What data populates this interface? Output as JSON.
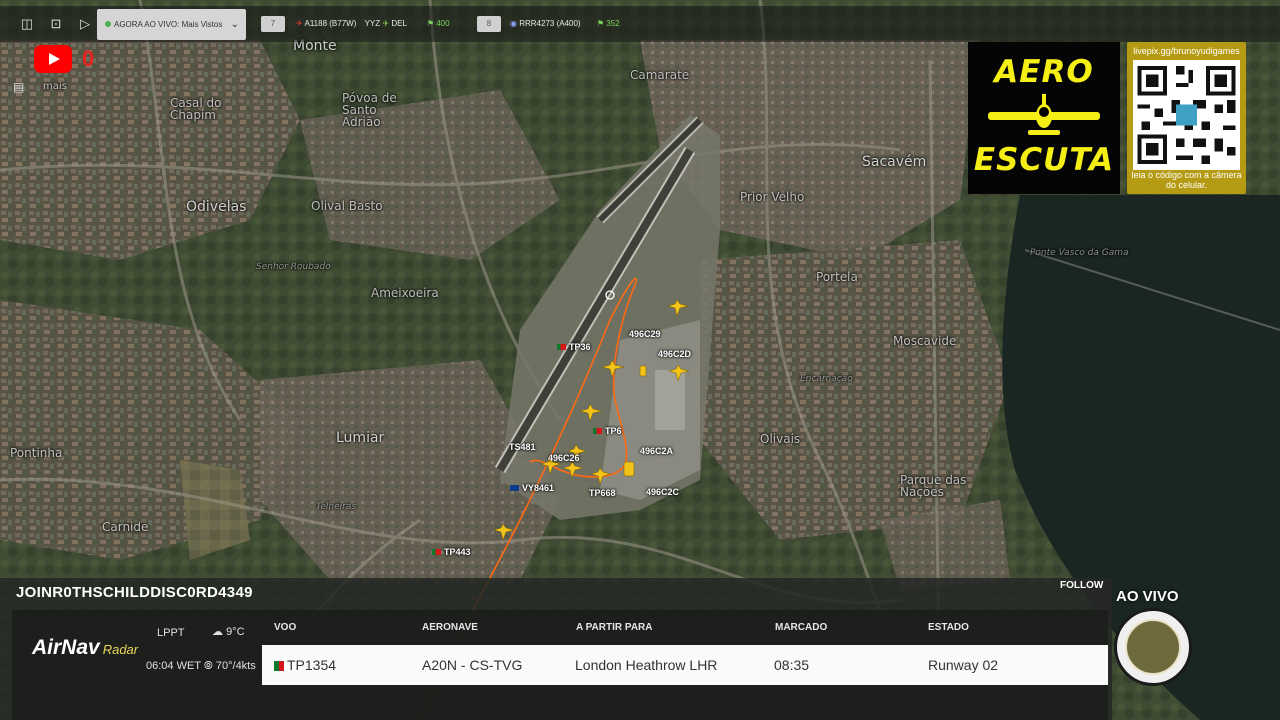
{
  "topbar": {
    "live_label": "AGORA AO VIVO: Mais Vistos",
    "slot1_number": "7",
    "slot1_flight": "A1188 (B77W)",
    "slot1_route_from": "YYZ",
    "slot1_route_to": "DEL",
    "slot1_count": "400",
    "slot2_number": "8",
    "slot2_flight": "RRR4273 (A400)",
    "slot2_count": "352"
  },
  "youtube": {
    "count": "0"
  },
  "map": {
    "places": [
      {
        "name": "Monte",
        "size": "big"
      },
      {
        "name": "Camarate",
        "size": "normal"
      },
      {
        "name": "Casal do Chapim",
        "size": "normal"
      },
      {
        "name": "Póvoa de Santo Adrião",
        "size": "normal"
      },
      {
        "name": "Odivelas",
        "size": "big"
      },
      {
        "name": "Olival Basto",
        "size": "normal"
      },
      {
        "name": "Sacavém",
        "size": "big"
      },
      {
        "name": "Prior Velho",
        "size": "normal"
      },
      {
        "name": "Senhor Roubado",
        "size": "small"
      },
      {
        "name": "Ameixoeira",
        "size": "normal"
      },
      {
        "name": "Portela",
        "size": "normal"
      },
      {
        "name": "Moscavide",
        "size": "normal"
      },
      {
        "name": "Lumiar",
        "size": "big"
      },
      {
        "name": "Olivais",
        "size": "normal"
      },
      {
        "name": "Parque das Nações",
        "size": "normal"
      },
      {
        "name": "Pontinha",
        "size": "normal"
      },
      {
        "name": "Carnide",
        "size": "normal"
      },
      {
        "name": "Telheiras",
        "size": "small"
      },
      {
        "name": "Encarnação",
        "size": "small"
      },
      {
        "name": "Ponte Vasco da Gama",
        "size": "small"
      },
      {
        "name": "mais",
        "size": "normal"
      }
    ],
    "aircraft_labels": [
      {
        "label": "TP36",
        "flag": "tp"
      },
      {
        "label": "496C29",
        "flag": "none"
      },
      {
        "label": "496C2D",
        "flag": "none"
      },
      {
        "label": "TP6",
        "flag": "tp"
      },
      {
        "label": "TS481",
        "flag": "none"
      },
      {
        "label": "496C2A",
        "flag": "none"
      },
      {
        "label": "496C26",
        "flag": "none"
      },
      {
        "label": "VY8461",
        "flag": "bl"
      },
      {
        "label": "TP668",
        "flag": "none"
      },
      {
        "label": "496C2C",
        "flag": "none"
      },
      {
        "label": "TP443",
        "flag": "tp"
      }
    ]
  },
  "aero_logo": {
    "top": "AERO",
    "bottom": "ESCUTA"
  },
  "qr": {
    "url": "livepix.gg/brunoyudigames",
    "hint": "leia o código com a câmera do celular."
  },
  "panel": {
    "channel_name": "JOINR0THSCHILDDISC0RD4349",
    "follow_label": "FOLLOW",
    "brand_main": "AirNav",
    "brand_sub": "Radar",
    "airport": "LPPT",
    "local_time": "06:04 WET",
    "temperature": "9°C",
    "wind": "70°/4kts",
    "columns": {
      "flight": "VOO",
      "aircraft": "AERONAVE",
      "from_to": "A PARTIR PARA",
      "scheduled": "MARCADO",
      "status": "ESTADO"
    },
    "row": {
      "flight": "TP1354",
      "aircraft": "A20N - CS-TVG",
      "from_to": "London Heathrow LHR",
      "scheduled": "08:35",
      "status": "Runway 02"
    }
  },
  "live_tag": "AO VIVO",
  "colors": {
    "accent_yellow": "#f5ef15",
    "track_orange": "#ff6a13",
    "aircraft_yellow": "#f2c318",
    "qr_gold": "#b59b14"
  }
}
